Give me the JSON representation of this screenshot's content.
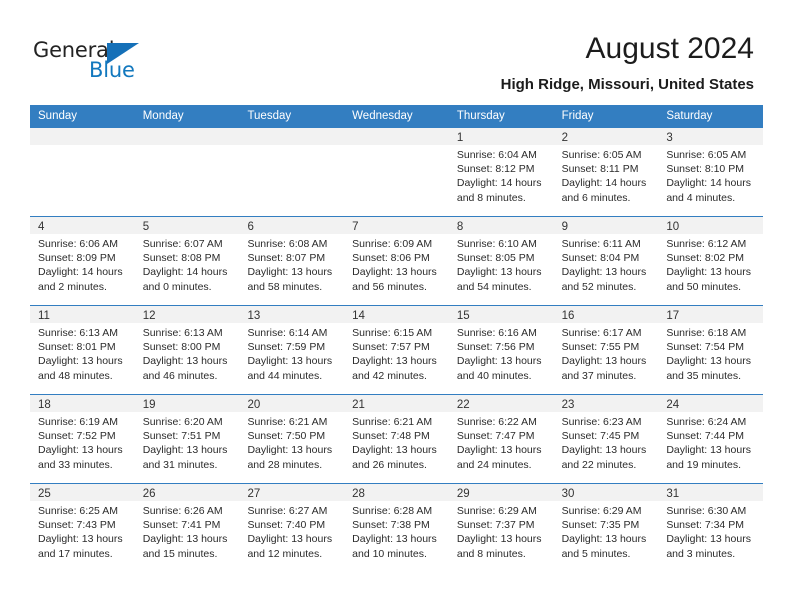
{
  "brand": {
    "name_part1": "General",
    "name_part2": "Blue",
    "accent_color": "#1570b8",
    "logo_icon": "triangle-flag-icon"
  },
  "header": {
    "title": "August 2024",
    "subtitle": "High Ridge, Missouri, United States"
  },
  "calendar": {
    "header_bg": "#337ec1",
    "daynumber_bg": "#f2f2f2",
    "weekdays": [
      "Sunday",
      "Monday",
      "Tuesday",
      "Wednesday",
      "Thursday",
      "Friday",
      "Saturday"
    ],
    "weeks": [
      [
        {
          "day": "",
          "sunrise": "",
          "sunset": "",
          "daylight1": "",
          "daylight2": ""
        },
        {
          "day": "",
          "sunrise": "",
          "sunset": "",
          "daylight1": "",
          "daylight2": ""
        },
        {
          "day": "",
          "sunrise": "",
          "sunset": "",
          "daylight1": "",
          "daylight2": ""
        },
        {
          "day": "",
          "sunrise": "",
          "sunset": "",
          "daylight1": "",
          "daylight2": ""
        },
        {
          "day": "1",
          "sunrise": "Sunrise: 6:04 AM",
          "sunset": "Sunset: 8:12 PM",
          "daylight1": "Daylight: 14 hours",
          "daylight2": "and 8 minutes."
        },
        {
          "day": "2",
          "sunrise": "Sunrise: 6:05 AM",
          "sunset": "Sunset: 8:11 PM",
          "daylight1": "Daylight: 14 hours",
          "daylight2": "and 6 minutes."
        },
        {
          "day": "3",
          "sunrise": "Sunrise: 6:05 AM",
          "sunset": "Sunset: 8:10 PM",
          "daylight1": "Daylight: 14 hours",
          "daylight2": "and 4 minutes."
        }
      ],
      [
        {
          "day": "4",
          "sunrise": "Sunrise: 6:06 AM",
          "sunset": "Sunset: 8:09 PM",
          "daylight1": "Daylight: 14 hours",
          "daylight2": "and 2 minutes."
        },
        {
          "day": "5",
          "sunrise": "Sunrise: 6:07 AM",
          "sunset": "Sunset: 8:08 PM",
          "daylight1": "Daylight: 14 hours",
          "daylight2": "and 0 minutes."
        },
        {
          "day": "6",
          "sunrise": "Sunrise: 6:08 AM",
          "sunset": "Sunset: 8:07 PM",
          "daylight1": "Daylight: 13 hours",
          "daylight2": "and 58 minutes."
        },
        {
          "day": "7",
          "sunrise": "Sunrise: 6:09 AM",
          "sunset": "Sunset: 8:06 PM",
          "daylight1": "Daylight: 13 hours",
          "daylight2": "and 56 minutes."
        },
        {
          "day": "8",
          "sunrise": "Sunrise: 6:10 AM",
          "sunset": "Sunset: 8:05 PM",
          "daylight1": "Daylight: 13 hours",
          "daylight2": "and 54 minutes."
        },
        {
          "day": "9",
          "sunrise": "Sunrise: 6:11 AM",
          "sunset": "Sunset: 8:04 PM",
          "daylight1": "Daylight: 13 hours",
          "daylight2": "and 52 minutes."
        },
        {
          "day": "10",
          "sunrise": "Sunrise: 6:12 AM",
          "sunset": "Sunset: 8:02 PM",
          "daylight1": "Daylight: 13 hours",
          "daylight2": "and 50 minutes."
        }
      ],
      [
        {
          "day": "11",
          "sunrise": "Sunrise: 6:13 AM",
          "sunset": "Sunset: 8:01 PM",
          "daylight1": "Daylight: 13 hours",
          "daylight2": "and 48 minutes."
        },
        {
          "day": "12",
          "sunrise": "Sunrise: 6:13 AM",
          "sunset": "Sunset: 8:00 PM",
          "daylight1": "Daylight: 13 hours",
          "daylight2": "and 46 minutes."
        },
        {
          "day": "13",
          "sunrise": "Sunrise: 6:14 AM",
          "sunset": "Sunset: 7:59 PM",
          "daylight1": "Daylight: 13 hours",
          "daylight2": "and 44 minutes."
        },
        {
          "day": "14",
          "sunrise": "Sunrise: 6:15 AM",
          "sunset": "Sunset: 7:57 PM",
          "daylight1": "Daylight: 13 hours",
          "daylight2": "and 42 minutes."
        },
        {
          "day": "15",
          "sunrise": "Sunrise: 6:16 AM",
          "sunset": "Sunset: 7:56 PM",
          "daylight1": "Daylight: 13 hours",
          "daylight2": "and 40 minutes."
        },
        {
          "day": "16",
          "sunrise": "Sunrise: 6:17 AM",
          "sunset": "Sunset: 7:55 PM",
          "daylight1": "Daylight: 13 hours",
          "daylight2": "and 37 minutes."
        },
        {
          "day": "17",
          "sunrise": "Sunrise: 6:18 AM",
          "sunset": "Sunset: 7:54 PM",
          "daylight1": "Daylight: 13 hours",
          "daylight2": "and 35 minutes."
        }
      ],
      [
        {
          "day": "18",
          "sunrise": "Sunrise: 6:19 AM",
          "sunset": "Sunset: 7:52 PM",
          "daylight1": "Daylight: 13 hours",
          "daylight2": "and 33 minutes."
        },
        {
          "day": "19",
          "sunrise": "Sunrise: 6:20 AM",
          "sunset": "Sunset: 7:51 PM",
          "daylight1": "Daylight: 13 hours",
          "daylight2": "and 31 minutes."
        },
        {
          "day": "20",
          "sunrise": "Sunrise: 6:21 AM",
          "sunset": "Sunset: 7:50 PM",
          "daylight1": "Daylight: 13 hours",
          "daylight2": "and 28 minutes."
        },
        {
          "day": "21",
          "sunrise": "Sunrise: 6:21 AM",
          "sunset": "Sunset: 7:48 PM",
          "daylight1": "Daylight: 13 hours",
          "daylight2": "and 26 minutes."
        },
        {
          "day": "22",
          "sunrise": "Sunrise: 6:22 AM",
          "sunset": "Sunset: 7:47 PM",
          "daylight1": "Daylight: 13 hours",
          "daylight2": "and 24 minutes."
        },
        {
          "day": "23",
          "sunrise": "Sunrise: 6:23 AM",
          "sunset": "Sunset: 7:45 PM",
          "daylight1": "Daylight: 13 hours",
          "daylight2": "and 22 minutes."
        },
        {
          "day": "24",
          "sunrise": "Sunrise: 6:24 AM",
          "sunset": "Sunset: 7:44 PM",
          "daylight1": "Daylight: 13 hours",
          "daylight2": "and 19 minutes."
        }
      ],
      [
        {
          "day": "25",
          "sunrise": "Sunrise: 6:25 AM",
          "sunset": "Sunset: 7:43 PM",
          "daylight1": "Daylight: 13 hours",
          "daylight2": "and 17 minutes."
        },
        {
          "day": "26",
          "sunrise": "Sunrise: 6:26 AM",
          "sunset": "Sunset: 7:41 PM",
          "daylight1": "Daylight: 13 hours",
          "daylight2": "and 15 minutes."
        },
        {
          "day": "27",
          "sunrise": "Sunrise: 6:27 AM",
          "sunset": "Sunset: 7:40 PM",
          "daylight1": "Daylight: 13 hours",
          "daylight2": "and 12 minutes."
        },
        {
          "day": "28",
          "sunrise": "Sunrise: 6:28 AM",
          "sunset": "Sunset: 7:38 PM",
          "daylight1": "Daylight: 13 hours",
          "daylight2": "and 10 minutes."
        },
        {
          "day": "29",
          "sunrise": "Sunrise: 6:29 AM",
          "sunset": "Sunset: 7:37 PM",
          "daylight1": "Daylight: 13 hours",
          "daylight2": "and 8 minutes."
        },
        {
          "day": "30",
          "sunrise": "Sunrise: 6:29 AM",
          "sunset": "Sunset: 7:35 PM",
          "daylight1": "Daylight: 13 hours",
          "daylight2": "and 5 minutes."
        },
        {
          "day": "31",
          "sunrise": "Sunrise: 6:30 AM",
          "sunset": "Sunset: 7:34 PM",
          "daylight1": "Daylight: 13 hours",
          "daylight2": "and 3 minutes."
        }
      ]
    ]
  }
}
